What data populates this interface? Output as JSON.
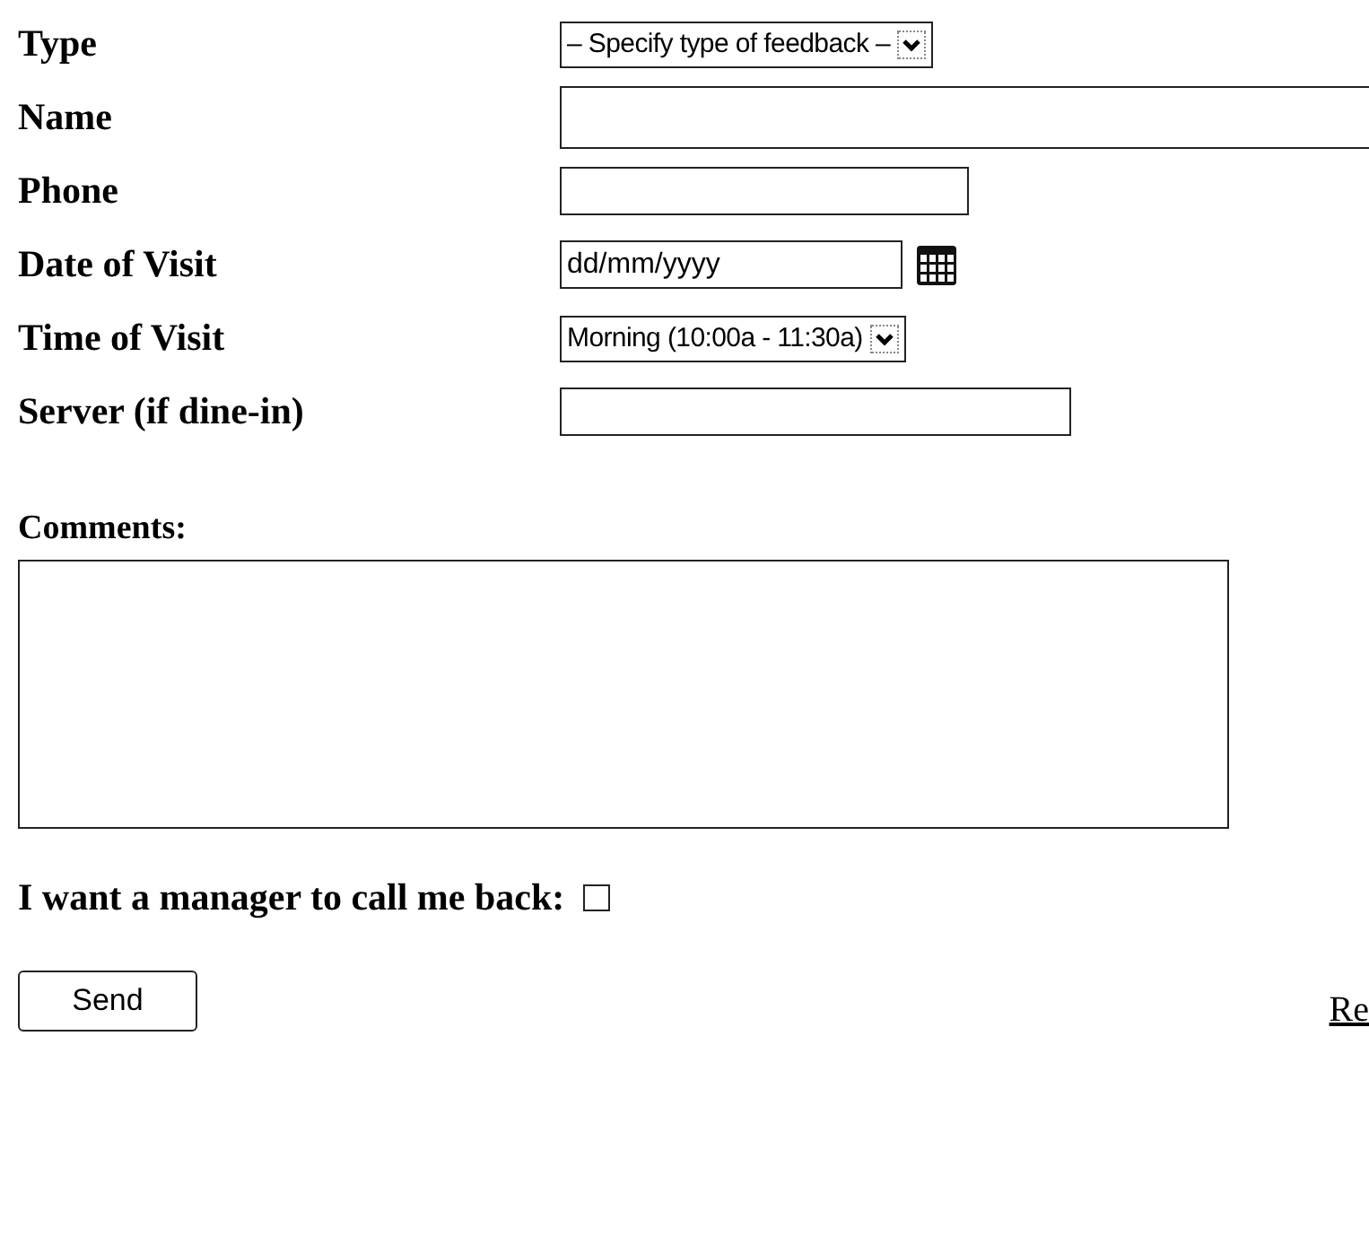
{
  "fields": [
    {
      "label": "Type",
      "kind": "select",
      "value": "– Specify type of feedback –"
    },
    {
      "label": "Name",
      "kind": "text"
    },
    {
      "label": "Phone",
      "kind": "text"
    },
    {
      "label": "Date of Visit",
      "kind": "date",
      "value": "dd/mm/yyyy"
    },
    {
      "label": "Time of Visit",
      "kind": "select",
      "value": "Morning (10:00a - 11:30a)"
    },
    {
      "label": "Server (if dine-in)",
      "kind": "text"
    }
  ],
  "comments": {
    "label": "Comments:"
  },
  "callback": {
    "label": "I want a manager to call me back:",
    "checked": false
  },
  "send_button": "Send",
  "link": "Re"
}
